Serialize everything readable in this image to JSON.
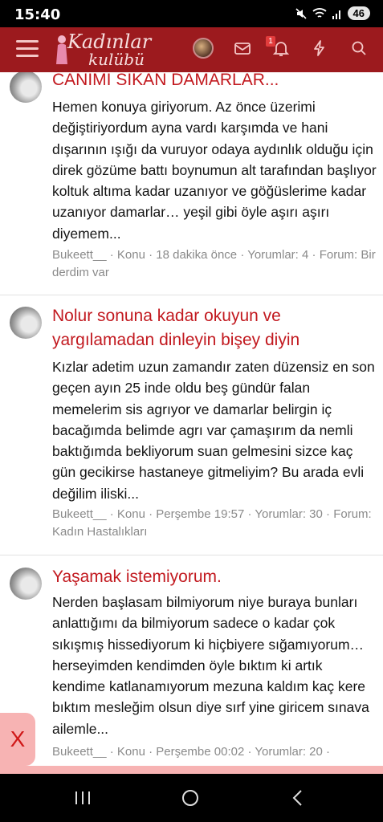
{
  "status": {
    "time": "15:40",
    "battery": "46"
  },
  "header": {
    "logo_line1": "Kadınlar",
    "logo_line2": "kulübü",
    "notification_count": "1"
  },
  "posts": [
    {
      "title": "CANIMI SIKAN DAMARLAR...",
      "body": "Hemen konuya giriyorum. Az önce üzerimi değiştiriyordum ayna vardı karşımda ve hani dışarının ışığı da vuruyor odaya aydınlık olduğu için direk gözüme battı boynumun alt tarafından başlıyor koltuk altıma kadar uzanıyor ve göğüslerime kadar uzanıyor damarlar… yeşil gibi öyle aşırı aşırı diyemem...",
      "meta": "Bukeett__ · Konu · 18 dakika önce · Yorumlar: 4 · Forum: Bir derdim var"
    },
    {
      "title": "Nolur sonuna kadar okuyun ve yargılamadan dinleyin bişey diyin",
      "body": "Kızlar adetim uzun zamandır zaten düzensiz en son geçen ayın 25 inde oldu beş gündür falan memelerim sis agrıyor ve damarlar belirgin iç bacağımda belimde agrı var çamaşırım da nemli baktığımda bekliyorum suan gelmesini sizce kaç gün gecikirse hastaneye gitmeliyim? Bu arada evli değilim iliski...",
      "meta": "Bukeett__ · Konu · Perşembe 19:57 · Yorumlar: 30 · Forum: Kadın Hastalıkları"
    },
    {
      "title": "Yaşamak istemiyorum.",
      "body": "Nerden başlasam bilmiyorum niye buraya bunları anlattığımı da bilmiyorum sadece o kadar çok sıkışmış hissediyorum ki hiçbiyere sığamıyorum… herseyimden kendimden öyle bıktım ki artık kendime katlanamıyorum mezuna kaldım kaç kere bıktım mesleğim olsun diye sırf yine giricem sınava ailemle...",
      "meta": "Bukeett__ · Konu · Perşembe 00:02 · Yorumlar: 20 ·"
    }
  ],
  "ad": {
    "close_label": "X"
  },
  "colors": {
    "brand": "#9c1a1e",
    "title": "#c2191f",
    "ad": "#f7b3b3"
  }
}
